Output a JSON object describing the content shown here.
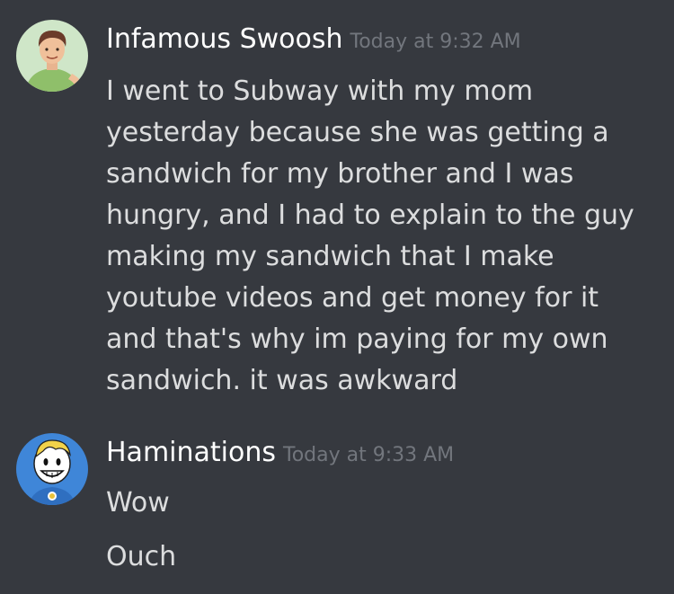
{
  "messages": [
    {
      "author": "Infamous Swoosh",
      "timestamp": "Today at 9:32 AM",
      "avatar_icon": "person-avatar-icon",
      "lines": [
        "I went to Subway with my mom yesterday because she was getting a sandwich for my brother and I was hungry, and I had to explain to the guy making my sandwich that I make youtube videos and get money for it and that's why im paying for my own sandwich. it was awkward"
      ]
    },
    {
      "author": "Haminations",
      "timestamp": "Today at 9:33 AM",
      "avatar_icon": "cartoon-avatar-icon",
      "lines": [
        "Wow",
        "Ouch"
      ]
    }
  ],
  "colors": {
    "background": "#36393f",
    "username": "#ffffff",
    "timestamp": "#72767d",
    "message_text": "#dcddde"
  }
}
